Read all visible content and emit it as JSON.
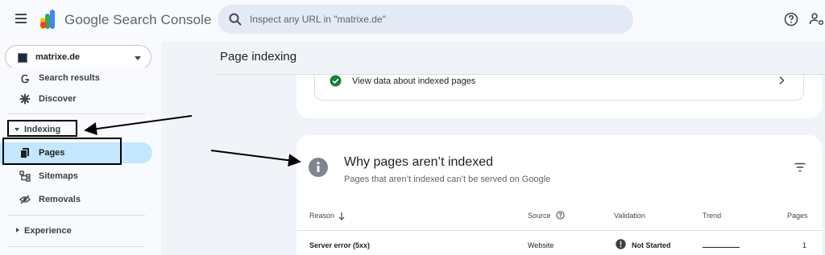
{
  "header": {
    "app_name": "Google Search Console",
    "search_placeholder": "Inspect any URL in \"matrixe.de\"",
    "icons": {
      "menu": "hamburger-icon",
      "search": "search-icon",
      "help": "help-icon",
      "users": "manage-users-icon"
    }
  },
  "sidebar": {
    "property": "matrixe.de",
    "items_top": [
      {
        "label": "Search results",
        "icon": "google-g-icon"
      },
      {
        "label": "Discover",
        "icon": "asterisk-icon"
      }
    ],
    "indexing_section": "Indexing",
    "indexing_items": [
      {
        "label": "Pages",
        "icon": "pages-icon",
        "active": true
      },
      {
        "label": "Sitemaps",
        "icon": "sitemap-icon",
        "active": false
      },
      {
        "label": "Removals",
        "icon": "eye-off-icon",
        "active": false
      }
    ],
    "experience_section": "Experience"
  },
  "main": {
    "page_title": "Page indexing",
    "indexed_card": {
      "link_label": "View data about indexed pages"
    },
    "not_indexed_card": {
      "title": "Why pages aren’t indexed",
      "subtitle": "Pages that aren’t indexed can’t be served on Google",
      "columns": {
        "reason": "Reason",
        "source": "Source",
        "validation": "Validation",
        "trend": "Trend",
        "pages": "Pages"
      },
      "rows": [
        {
          "reason": "Server error (5xx)",
          "source": "Website",
          "validation": "Not Started",
          "pages": "1"
        }
      ]
    }
  },
  "colors": {
    "active_nav": "#c2e7ff",
    "check_green": "#188038",
    "search_bg": "#e3eaf6"
  }
}
